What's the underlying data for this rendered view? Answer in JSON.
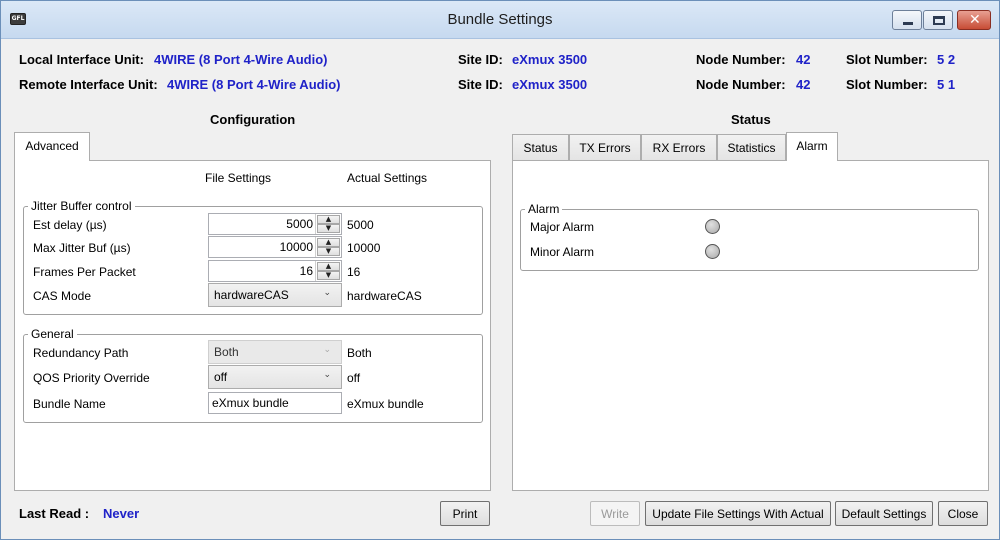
{
  "window": {
    "title": "Bundle Settings",
    "icon_text": "GFL"
  },
  "header": {
    "local_label": "Local Interface Unit:",
    "local_value": "4WIRE (8 Port 4-Wire Audio)",
    "remote_label": "Remote Interface Unit:",
    "remote_value": "4WIRE (8 Port 4-Wire Audio)",
    "site_label": "Site ID:",
    "local_site": "eXmux 3500",
    "remote_site": "eXmux 3500",
    "node_label": "Node Number:",
    "local_node": "42",
    "remote_node": "42",
    "slot_label": "Slot Number:",
    "local_slot": "5 2",
    "remote_slot": "5 1"
  },
  "configuration": {
    "title": "Configuration",
    "tabs": [
      "Advanced"
    ],
    "file_settings_header": "File Settings",
    "actual_settings_header": "Actual Settings",
    "jitter_group": {
      "legend": "Jitter Buffer control",
      "est_delay_label": "Est delay (µs)",
      "est_delay_value": "5000",
      "est_delay_actual": "5000",
      "max_jitter_label": "Max Jitter Buf (µs)",
      "max_jitter_value": "10000",
      "max_jitter_actual": "10000",
      "frames_label": "Frames Per Packet",
      "frames_value": "16",
      "frames_actual": "16",
      "cas_label": "CAS Mode",
      "cas_value": "hardwareCAS",
      "cas_actual": "hardwareCAS"
    },
    "general_group": {
      "legend": "General",
      "redundancy_label": "Redundancy Path",
      "redundancy_value": "Both",
      "redundancy_actual": "Both",
      "qos_label": "QOS Priority Override",
      "qos_value": "off",
      "qos_actual": "off",
      "bundle_name_label": "Bundle Name",
      "bundle_name_value": "eXmux bundle",
      "bundle_name_actual": "eXmux bundle"
    }
  },
  "status": {
    "title": "Status",
    "tabs": [
      "Status",
      "TX Errors",
      "RX Errors",
      "Statistics",
      "Alarm"
    ],
    "active_tab": "Alarm",
    "alarm_group": {
      "legend": "Alarm",
      "major_label": "Major Alarm",
      "minor_label": "Minor Alarm"
    }
  },
  "footer": {
    "last_read_label": "Last Read :",
    "last_read_value": "Never",
    "print_label": "Print",
    "write_label": "Write",
    "update_label": "Update File Settings With Actual",
    "default_label": "Default Settings",
    "close_label": "Close"
  },
  "icons": {
    "spin_up": "up-arrow-icon",
    "spin_down": "down-arrow-icon",
    "dropdown": "chevron-down-icon"
  },
  "colors": {
    "value_blue": "#1f22c8",
    "led_gray": "#a9a9a9"
  }
}
